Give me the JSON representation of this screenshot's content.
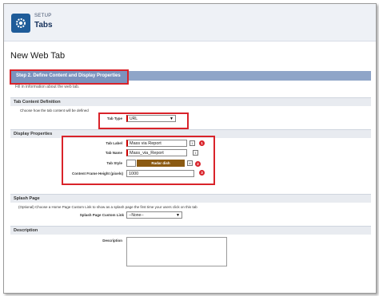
{
  "header": {
    "eyebrow": "SETUP",
    "title": "Tabs"
  },
  "page": {
    "title": "New Web Tab"
  },
  "step": {
    "label": "Step 2. Define Content and Display Properties"
  },
  "hint": "Fill in information about the web tab.",
  "tab_content": {
    "section_title": "Tab Content Definition",
    "instruction": "Choose how the tab content will be defined",
    "tab_type_label": "Tab Type",
    "tab_type_value": "URL"
  },
  "display": {
    "section_title": "Display Properties",
    "tab_label_label": "Tab Label",
    "tab_label_value": "Mass via Report",
    "tab_name_label": "Tab Name",
    "tab_name_value": "Mass_via_Report",
    "tab_style_label": "Tab Style",
    "tab_style_value": "Radar dish",
    "frame_height_label": "Content Frame Height (pixels)",
    "frame_height_value": "1000",
    "badges": [
      "1",
      "2",
      "3"
    ],
    "help_glyph": "i",
    "lookup_glyph": "⌕"
  },
  "splash": {
    "section_title": "Splash Page",
    "instruction": "(Optional) Choose a Home Page Custom Link to show as a splash page the first time your users click on this tab",
    "link_label": "Splash Page Custom Link",
    "link_value": "--None--"
  },
  "description": {
    "section_title": "Description",
    "field_label": "Description"
  },
  "colors": {
    "accent_red": "#d9232a",
    "step_bar": "#7b93be",
    "style_bar": "#8b5a12",
    "header_bg": "#eef1f6",
    "icon_bg": "#1f5c99"
  }
}
